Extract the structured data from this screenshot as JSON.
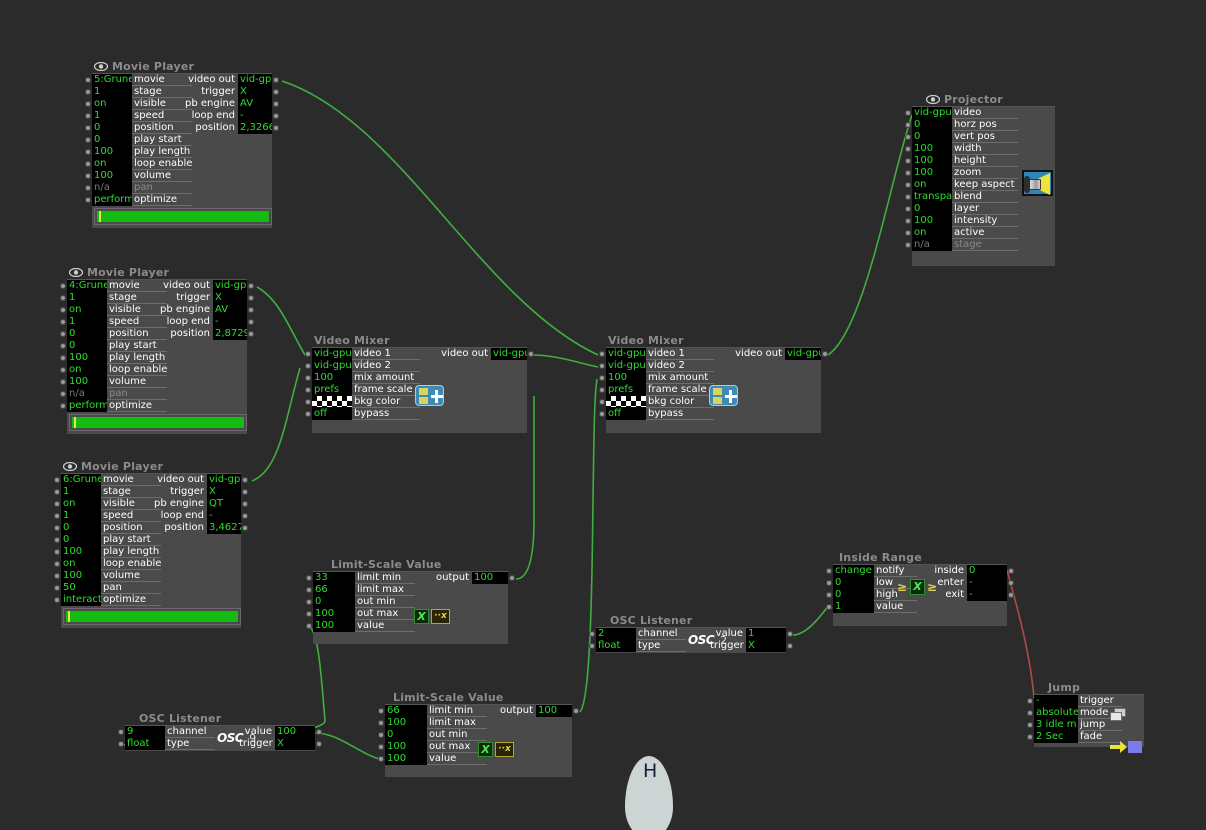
{
  "canvas": {
    "background": "#2b2b2b",
    "wire_color": "#3fae3f",
    "wire_color_alt": "#b04a4a"
  },
  "cursor": {
    "letter": "H"
  },
  "nodes": {
    "movie_player_1": {
      "title": "Movie Player",
      "inputs": [
        {
          "value": "5:Grune",
          "label": "movie"
        },
        {
          "value": "1",
          "label": "stage"
        },
        {
          "value": "on",
          "label": "visible"
        },
        {
          "value": "1",
          "label": "speed"
        },
        {
          "value": "0",
          "label": "position"
        },
        {
          "value": "0",
          "label": "play start"
        },
        {
          "value": "100",
          "label": "play length"
        },
        {
          "value": "on",
          "label": "loop enable"
        },
        {
          "value": "100",
          "label": "volume"
        },
        {
          "value": "n/a",
          "label": "pan",
          "dim": true
        },
        {
          "value": "performa",
          "label": "optimize"
        }
      ],
      "outputs": [
        {
          "label": "video out",
          "value": "vid-gpu"
        },
        {
          "label": "trigger",
          "value": "X"
        },
        {
          "label": "pb engine",
          "value": "AV"
        },
        {
          "label": "loop end",
          "value": "-"
        },
        {
          "label": "position",
          "value": "2,3266"
        }
      ]
    },
    "movie_player_2": {
      "title": "Movie Player",
      "inputs": [
        {
          "value": "4:Grune",
          "label": "movie"
        },
        {
          "value": "1",
          "label": "stage"
        },
        {
          "value": "on",
          "label": "visible"
        },
        {
          "value": "1",
          "label": "speed"
        },
        {
          "value": "0",
          "label": "position"
        },
        {
          "value": "0",
          "label": "play start"
        },
        {
          "value": "100",
          "label": "play length"
        },
        {
          "value": "on",
          "label": "loop enable"
        },
        {
          "value": "100",
          "label": "volume"
        },
        {
          "value": "n/a",
          "label": "pan",
          "dim": true
        },
        {
          "value": "performa",
          "label": "optimize"
        }
      ],
      "outputs": [
        {
          "label": "video out",
          "value": "vid-gpu"
        },
        {
          "label": "trigger",
          "value": "X"
        },
        {
          "label": "pb engine",
          "value": "AV"
        },
        {
          "label": "loop end",
          "value": "-"
        },
        {
          "label": "position",
          "value": "2,8729"
        }
      ]
    },
    "movie_player_3": {
      "title": "Movie Player",
      "inputs": [
        {
          "value": "6:Grune",
          "label": "movie"
        },
        {
          "value": "1",
          "label": "stage"
        },
        {
          "value": "on",
          "label": "visible"
        },
        {
          "value": "1",
          "label": "speed"
        },
        {
          "value": "0",
          "label": "position"
        },
        {
          "value": "0",
          "label": "play start"
        },
        {
          "value": "100",
          "label": "play length"
        },
        {
          "value": "on",
          "label": "loop enable"
        },
        {
          "value": "100",
          "label": "volume"
        },
        {
          "value": "50",
          "label": "pan"
        },
        {
          "value": "interacti",
          "label": "optimize"
        }
      ],
      "outputs": [
        {
          "label": "video out",
          "value": "vid-gpu"
        },
        {
          "label": "trigger",
          "value": "X"
        },
        {
          "label": "pb engine",
          "value": "QT"
        },
        {
          "label": "loop end",
          "value": "-"
        },
        {
          "label": "position",
          "value": "3,4627"
        }
      ]
    },
    "projector": {
      "title": "Projector",
      "icon": "projector-icon",
      "inputs": [
        {
          "value": "vid-gpu",
          "label": "video"
        },
        {
          "value": "0",
          "label": "horz pos"
        },
        {
          "value": "0",
          "label": "vert pos"
        },
        {
          "value": "100",
          "label": "width"
        },
        {
          "value": "100",
          "label": "height"
        },
        {
          "value": "100",
          "label": "zoom"
        },
        {
          "value": "on",
          "label": "keep aspect"
        },
        {
          "value": "transpar",
          "label": "blend"
        },
        {
          "value": "0",
          "label": "layer"
        },
        {
          "value": "100",
          "label": "intensity"
        },
        {
          "value": "on",
          "label": "active"
        },
        {
          "value": "n/a",
          "label": "stage",
          "dim": true
        }
      ]
    },
    "video_mixer_1": {
      "title": "Video Mixer",
      "icon": "mixer-icon",
      "inputs": [
        {
          "value": "vid-gpu",
          "label": "video 1"
        },
        {
          "value": "vid-gpu",
          "label": "video 2"
        },
        {
          "value": "100",
          "label": "mix amount"
        },
        {
          "value": "prefs",
          "label": "frame scale"
        },
        {
          "value": "",
          "label": "bkg color",
          "swatch": "checker"
        },
        {
          "value": "off",
          "label": "bypass"
        }
      ],
      "outputs": [
        {
          "label": "video out",
          "value": "vid-gpu"
        }
      ]
    },
    "video_mixer_2": {
      "title": "Video Mixer",
      "icon": "mixer-icon",
      "inputs": [
        {
          "value": "vid-gpu",
          "label": "video 1"
        },
        {
          "value": "vid-gpu",
          "label": "video 2"
        },
        {
          "value": "100",
          "label": "mix amount"
        },
        {
          "value": "prefs",
          "label": "frame scale"
        },
        {
          "value": "",
          "label": "bkg color",
          "swatch": "checker"
        },
        {
          "value": "off",
          "label": "bypass"
        }
      ],
      "outputs": [
        {
          "label": "video out",
          "value": "vid-gpu"
        }
      ]
    },
    "limit_scale_1": {
      "title": "Limit-Scale Value",
      "icon": "scale-icon",
      "inputs": [
        {
          "value": "33",
          "label": "limit min"
        },
        {
          "value": "66",
          "label": "limit max"
        },
        {
          "value": "0",
          "label": "out min"
        },
        {
          "value": "100",
          "label": "out max"
        },
        {
          "value": "100",
          "label": "value"
        }
      ],
      "outputs": [
        {
          "label": "output",
          "value": "100"
        }
      ]
    },
    "limit_scale_2": {
      "title": "Limit-Scale Value",
      "icon": "scale-icon",
      "inputs": [
        {
          "value": "66",
          "label": "limit min"
        },
        {
          "value": "100",
          "label": "limit max"
        },
        {
          "value": "0",
          "label": "out min"
        },
        {
          "value": "100",
          "label": "out max"
        },
        {
          "value": "100",
          "label": "value"
        }
      ],
      "outputs": [
        {
          "label": "output",
          "value": "100"
        }
      ]
    },
    "osc_listener_1": {
      "title": "OSC Listener",
      "icon": "osc-icon",
      "icon_label": "OSC",
      "icon_number": "2",
      "inputs": [
        {
          "value": "2",
          "label": "channel"
        },
        {
          "value": "float",
          "label": "type"
        }
      ],
      "outputs": [
        {
          "label": "value",
          "value": "1"
        },
        {
          "label": "trigger",
          "value": "X"
        }
      ]
    },
    "osc_listener_2": {
      "title": "OSC Listener",
      "icon": "osc-icon",
      "icon_label": "OSC",
      "icon_number": "9",
      "inputs": [
        {
          "value": "9",
          "label": "channel"
        },
        {
          "value": "float",
          "label": "type"
        }
      ],
      "outputs": [
        {
          "label": "value",
          "value": "100"
        },
        {
          "label": "trigger",
          "value": "X"
        }
      ]
    },
    "inside_range": {
      "title": "Inside Range",
      "icon": "range-icon",
      "inputs": [
        {
          "value": "change",
          "label": "notify"
        },
        {
          "value": "0",
          "label": "low"
        },
        {
          "value": "0",
          "label": "high"
        },
        {
          "value": "1",
          "label": "value"
        }
      ],
      "outputs": [
        {
          "label": "inside",
          "value": "0"
        },
        {
          "label": "enter",
          "value": "-"
        },
        {
          "label": "exit",
          "value": "-"
        }
      ]
    },
    "jump": {
      "title": "Jump",
      "inputs": [
        {
          "value": "-",
          "label": "trigger"
        },
        {
          "value": "absolute",
          "label": "mode"
        },
        {
          "value": "3 idle m",
          "label": "jump"
        },
        {
          "value": "2 Sec",
          "label": "fade"
        }
      ]
    }
  }
}
